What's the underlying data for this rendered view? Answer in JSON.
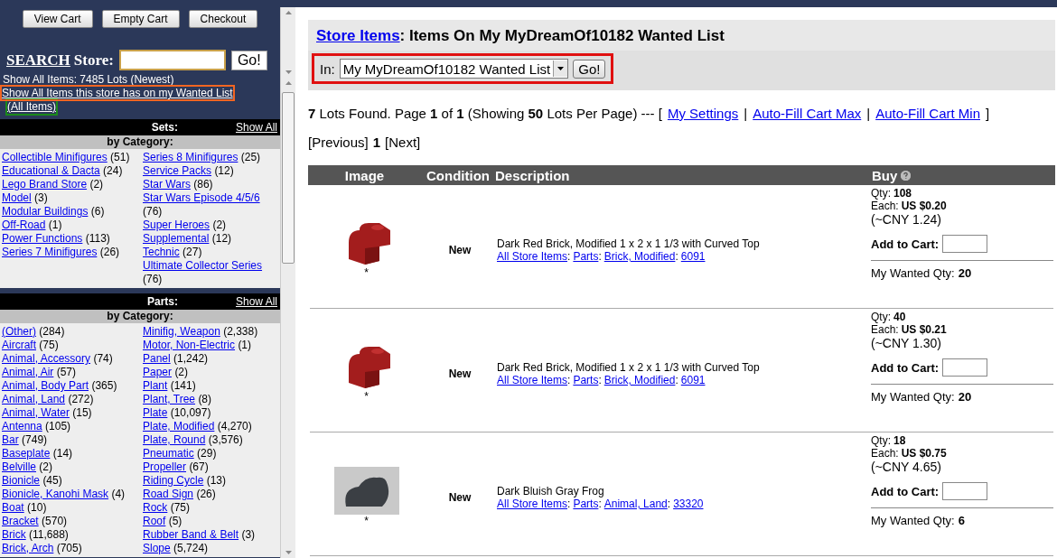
{
  "cart_buttons": [
    "View Cart",
    "Empty Cart",
    "Checkout"
  ],
  "search": {
    "link": "SEARCH",
    "label": "Store:",
    "button": "Go!"
  },
  "show_all_items": "Show All Items: 7485 Lots (Newest)",
  "wanted_link": "Show All Items this store has on my Wanted List",
  "all_items_link": "(All Items)",
  "sections": [
    {
      "title": "Sets:",
      "show_all": "Show All",
      "subtitle": "by Category:",
      "columns": [
        [
          {
            "name": "Collectible Minifigures",
            "count": "(51)"
          },
          {
            "name": "Educational & Dacta",
            "count": "(24)"
          },
          {
            "name": "Lego Brand Store",
            "count": "(2)"
          },
          {
            "name": "Model",
            "count": "(3)"
          },
          {
            "name": "Modular Buildings",
            "count": "(6)"
          },
          {
            "name": "Off-Road",
            "count": "(1)"
          },
          {
            "name": "Power Functions",
            "count": "(113)"
          },
          {
            "name": "Series 7 Minifigures",
            "count": "(26)"
          }
        ],
        [
          {
            "name": "Series 8 Minifigures",
            "count": "(25)"
          },
          {
            "name": "Service Packs",
            "count": "(12)"
          },
          {
            "name": "Star Wars",
            "count": "(86)"
          },
          {
            "name": "Star Wars Episode 4/5/6",
            "count": "(76)"
          },
          {
            "name": "Super Heroes",
            "count": "(2)"
          },
          {
            "name": "Supplemental",
            "count": "(12)"
          },
          {
            "name": "Technic",
            "count": "(27)"
          },
          {
            "name": "Ultimate Collector Series",
            "count": "(76)"
          }
        ]
      ]
    },
    {
      "title": "Parts:",
      "show_all": "Show All",
      "subtitle": "by Category:",
      "columns": [
        [
          {
            "name": "(Other)",
            "count": "(284)"
          },
          {
            "name": "Aircraft",
            "count": "(75)"
          },
          {
            "name": "Animal, Accessory",
            "count": "(74)"
          },
          {
            "name": "Animal, Air",
            "count": "(57)"
          },
          {
            "name": "Animal, Body Part",
            "count": "(365)"
          },
          {
            "name": "Animal, Land",
            "count": "(272)"
          },
          {
            "name": "Animal, Water",
            "count": "(15)"
          },
          {
            "name": "Antenna",
            "count": "(105)"
          },
          {
            "name": "Bar",
            "count": "(749)"
          },
          {
            "name": "Baseplate",
            "count": "(14)"
          },
          {
            "name": "Belville",
            "count": "(2)"
          },
          {
            "name": "Bionicle",
            "count": "(45)"
          },
          {
            "name": "Bionicle, Kanohi Mask",
            "count": "(4)"
          },
          {
            "name": "Boat",
            "count": "(10)"
          },
          {
            "name": "Bracket",
            "count": "(570)"
          },
          {
            "name": "Brick",
            "count": "(11,688)"
          },
          {
            "name": "Brick, Arch",
            "count": "(705)"
          }
        ],
        [
          {
            "name": "Minifig, Weapon",
            "count": "(2,338)"
          },
          {
            "name": "Motor, Non-Electric",
            "count": "(1)"
          },
          {
            "name": "Panel",
            "count": "(1,242)"
          },
          {
            "name": "Paper",
            "count": "(2)"
          },
          {
            "name": "Plant",
            "count": "(141)"
          },
          {
            "name": "Plant, Tree",
            "count": "(8)"
          },
          {
            "name": "Plate",
            "count": "(10,097)"
          },
          {
            "name": "Plate, Modified",
            "count": "(4,270)"
          },
          {
            "name": "Plate, Round",
            "count": "(3,576)"
          },
          {
            "name": "Pneumatic",
            "count": "(29)"
          },
          {
            "name": "Propeller",
            "count": "(67)"
          },
          {
            "name": "Riding Cycle",
            "count": "(13)"
          },
          {
            "name": "Road Sign",
            "count": "(26)"
          },
          {
            "name": "Rock",
            "count": "(75)"
          },
          {
            "name": "Roof",
            "count": "(5)"
          },
          {
            "name": "Rubber Band & Belt",
            "count": "(3)"
          },
          {
            "name": "Slope",
            "count": "(5,724)"
          }
        ]
      ]
    }
  ],
  "header": {
    "link": "Store Items",
    "title": ": Items On My MyDreamOf10182 Wanted List"
  },
  "filter": {
    "label": "In:",
    "value": "My MyDreamOf10182 Wanted List",
    "button": "Go!"
  },
  "summary": "**7** Lots Found. Page **1** of **1** (Showing **50** Lots Per Page) --- [",
  "summary_links": [
    "My Settings",
    "Auto-Fill Cart Max",
    "Auto-Fill Cart Min"
  ],
  "summary_separator": "|",
  "summary_end": "]",
  "pager": {
    "prev": "[Previous]",
    "page": "1",
    "next": "[Next]"
  },
  "columns": [
    "Image",
    "Condition",
    "Description",
    "Buy"
  ],
  "path_separator": ":",
  "items": [
    {
      "kind": "brick",
      "mark": "*",
      "condition": "New",
      "description": "Dark Red Brick, Modified 1 x 2 x 1 1/3 with Curved Top",
      "path": [
        "All Store Items",
        "Parts",
        "Brick, Modified",
        "6091"
      ],
      "qty_label": "Qty:",
      "qty": "108",
      "each_label": "Each:",
      "each": "US $0.20",
      "converted": "(~CNY 1.24)",
      "add_label": "Add to Cart:",
      "wanted_label": "My Wanted Qty:",
      "wanted": "20"
    },
    {
      "kind": "brick",
      "mark": "*",
      "condition": "New",
      "description": "Dark Red Brick, Modified 1 x 2 x 1 1/3 with Curved Top",
      "path": [
        "All Store Items",
        "Parts",
        "Brick, Modified",
        "6091"
      ],
      "qty_label": "Qty:",
      "qty": "40",
      "each_label": "Each:",
      "each": "US $0.21",
      "converted": "(~CNY 1.30)",
      "add_label": "Add to Cart:",
      "wanted_label": "My Wanted Qty:",
      "wanted": "20"
    },
    {
      "kind": "photo",
      "mark": "*",
      "condition": "New",
      "description": "Dark Bluish Gray Frog",
      "path": [
        "All Store Items",
        "Parts",
        "Animal, Land",
        "33320"
      ],
      "qty_label": "Qty:",
      "qty": "18",
      "each_label": "Each:",
      "each": "US $0.75",
      "converted": "(~CNY 4.65)",
      "add_label": "Add to Cart:",
      "wanted_label": "My Wanted Qty:",
      "wanted": "6"
    }
  ]
}
